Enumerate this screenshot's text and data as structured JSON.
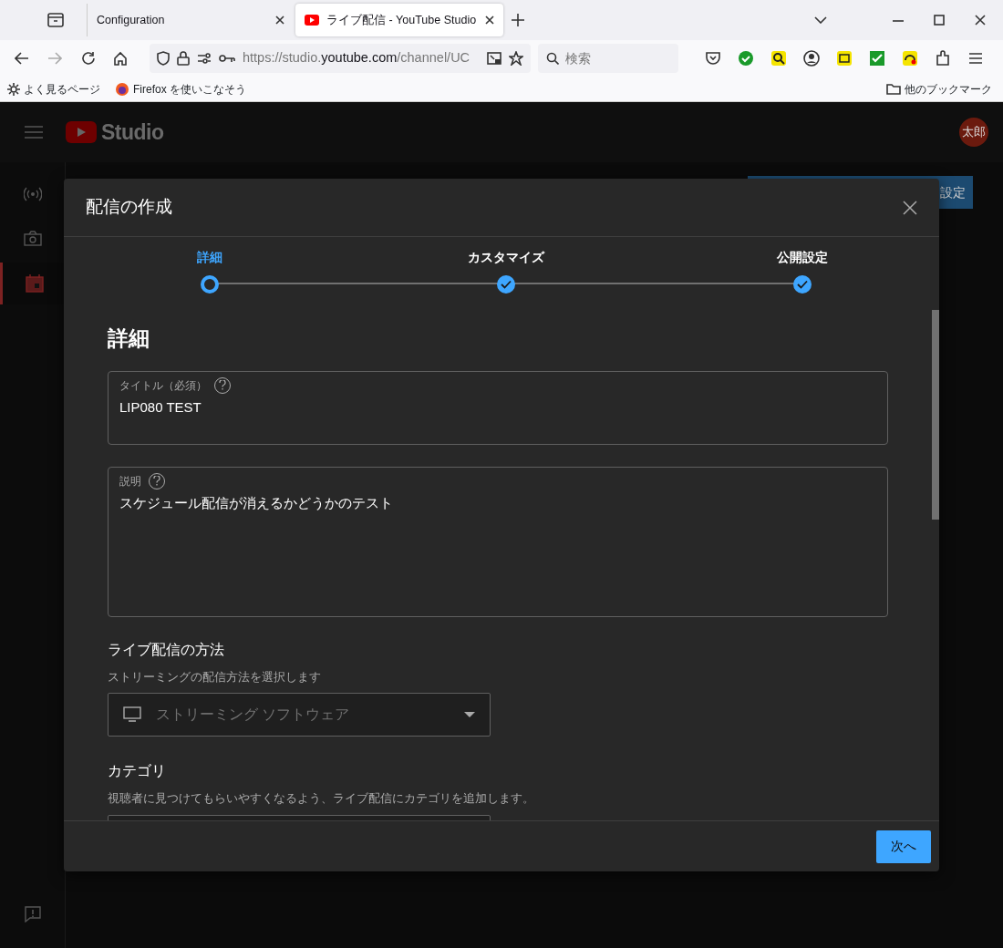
{
  "browser": {
    "tabs": [
      {
        "title": "Configuration",
        "selected": false
      },
      {
        "title": "ライブ配信 - YouTube Studio",
        "selected": true
      }
    ],
    "url": {
      "prefix": "https://studio.",
      "domain": "youtube.com",
      "path": "/channel/UC"
    },
    "search": {
      "placeholder": "検索"
    },
    "bookmarks": [
      {
        "kind": "gear",
        "label": "よく見るページ"
      },
      {
        "kind": "firefox",
        "label": "Firefox を使いこなそう"
      }
    ],
    "other_bookmarks": "他のブックマーク"
  },
  "studio": {
    "logo_text": "Studio",
    "avatar": "太郎",
    "background_button": "設定",
    "sidebar": [
      {
        "kind": "live",
        "selected": false
      },
      {
        "kind": "camera",
        "selected": false
      },
      {
        "kind": "calendar",
        "selected": true
      }
    ]
  },
  "dialog": {
    "title": "配信の作成",
    "steps": [
      {
        "label": "詳細",
        "selected": true,
        "done": false
      },
      {
        "label": "カスタマイズ",
        "selected": false,
        "done": true
      },
      {
        "label": "公開設定",
        "selected": false,
        "done": true
      }
    ],
    "section_title": "詳細",
    "fields": [
      {
        "label": "タイトル（必須）",
        "value": "LIP080 TEST"
      },
      {
        "label": "説明",
        "value": "スケジュール配信が消えるかどうかのテスト"
      }
    ],
    "method": {
      "heading": "ライブ配信の方法",
      "hint": "ストリーミングの配信方法を選択します",
      "dropdown": {
        "value": "ストリーミング ソフトウェア"
      }
    },
    "category": {
      "heading": "カテゴリ",
      "hint": "視聴者に見つけてもらいやすくなるよう、ライブ配信にカテゴリを追加します。"
    },
    "next_button": "次へ"
  }
}
